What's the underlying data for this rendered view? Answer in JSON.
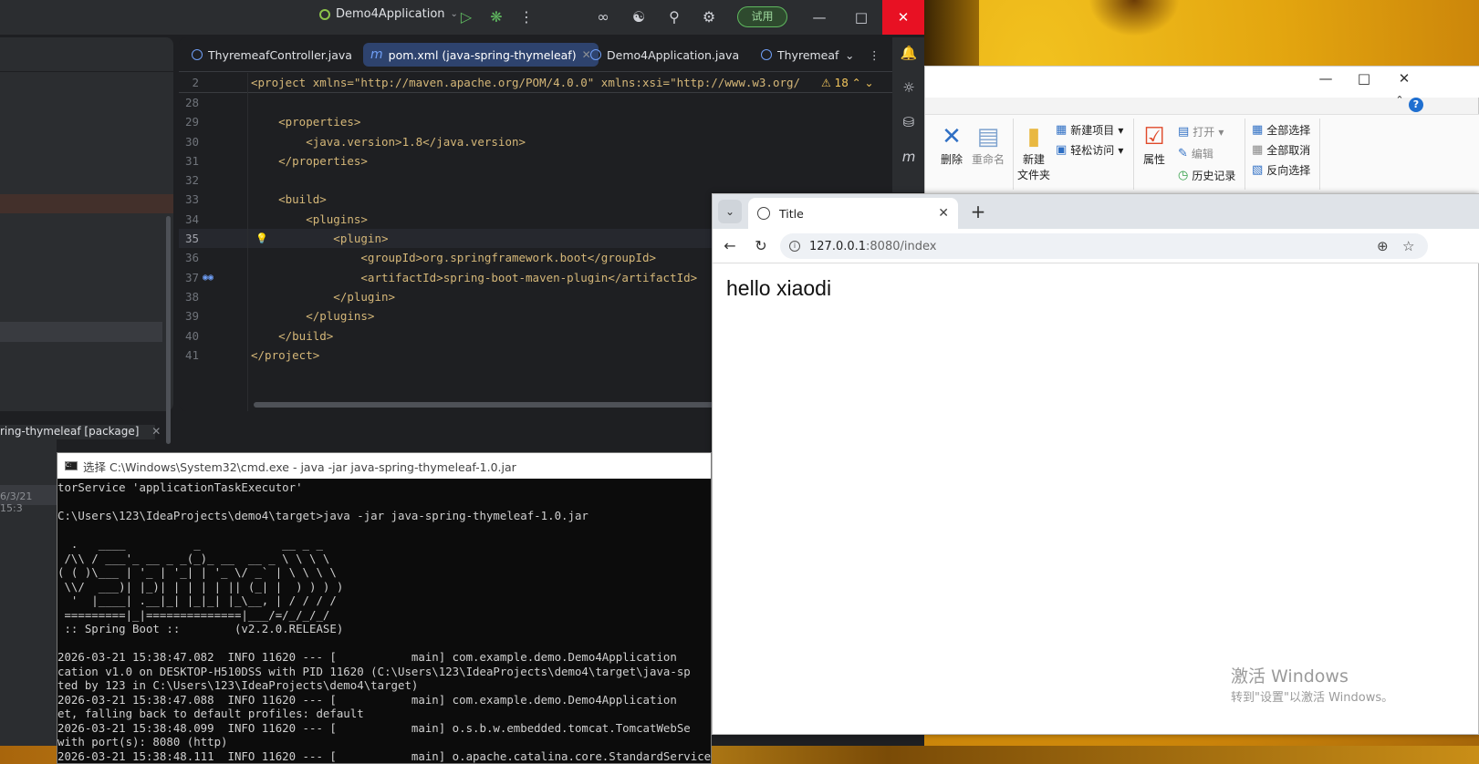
{
  "ide": {
    "run_config": "Demo4Application",
    "trial_label": "试用",
    "tabs": [
      {
        "label": "ThyremeafController.java"
      },
      {
        "label": "pom.xml (java-spring-thymeleaf)"
      },
      {
        "label": "Demo4Application.java"
      },
      {
        "label": "Thyremeaf"
      }
    ],
    "sticky": {
      "line": "2",
      "text": "<project xmlns=\"http://maven.apache.org/POM/4.0.0\" xmlns:xsi=\"http://www.w3.org/",
      "warnings": "18"
    },
    "lines": [
      {
        "n": "28",
        "c": ""
      },
      {
        "n": "29",
        "c": "    <properties>"
      },
      {
        "n": "30",
        "c": "        <java.version>1.8</java.version>"
      },
      {
        "n": "31",
        "c": "    </properties>"
      },
      {
        "n": "32",
        "c": ""
      },
      {
        "n": "33",
        "c": "    <build>"
      },
      {
        "n": "34",
        "c": "        <plugins>"
      },
      {
        "n": "35",
        "c": "            <plugin>"
      },
      {
        "n": "36",
        "c": "                <groupId>org.springframework.boot</groupId>"
      },
      {
        "n": "37",
        "c": "                <artifactId>spring-boot-maven-plugin</artifactId>"
      },
      {
        "n": "38",
        "c": "            </plugin>"
      },
      {
        "n": "39",
        "c": "        </plugins>"
      },
      {
        "n": "40",
        "c": "    </build>"
      },
      {
        "n": "41",
        "c": "</project>"
      }
    ],
    "bottom_tab": "ring-thymeleaf [package]",
    "side_time": "6/3/21 15:3"
  },
  "explorer": {
    "delete": "删除",
    "rename": "重命名",
    "new_folder_1": "新建",
    "new_folder_2": "文件夹",
    "new_item": "新建项目",
    "easy_access": "轻松访问",
    "properties": "属性",
    "open": "打开",
    "edit": "编辑",
    "history": "历史记录",
    "select_all": "全部选择",
    "select_none": "全部取消",
    "invert": "反向选择"
  },
  "browser": {
    "tab_title": "Title",
    "url_host": "127.0.0.1",
    "url_rest": ":8080/index",
    "page_text": "hello xiaodi",
    "watermark_1": "激活 Windows",
    "watermark_2": "转到\"设置\"以激活 Windows。"
  },
  "cmd": {
    "title": "选择 C:\\Windows\\System32\\cmd.exe - java  -jar java-spring-thymeleaf-1.0.jar",
    "lines": [
      "torService 'applicationTaskExecutor'",
      "",
      "C:\\Users\\123\\IdeaProjects\\demo4\\target>java -jar java-spring-thymeleaf-1.0.jar",
      "",
      "  .   ____          _            __ _ _",
      " /\\\\ / ___'_ __ _ _(_)_ __  __ _ \\ \\ \\ \\",
      "( ( )\\___ | '_ | '_| | '_ \\/ _` | \\ \\ \\ \\",
      " \\\\/  ___)| |_)| | | | | || (_| |  ) ) ) )",
      "  '  |____| .__|_| |_|_| |_\\__, | / / / /",
      " =========|_|==============|___/=/_/_/_/",
      " :: Spring Boot ::        (v2.2.0.RELEASE)",
      "",
      "2026-03-21 15:38:47.082  INFO 11620 --- [           main] com.example.demo.Demo4Application",
      "cation v1.0 on DESKTOP-H510DSS with PID 11620 (C:\\Users\\123\\IdeaProjects\\demo4\\target\\java-sp",
      "ted by 123 in C:\\Users\\123\\IdeaProjects\\demo4\\target)",
      "2026-03-21 15:38:47.088  INFO 11620 --- [           main] com.example.demo.Demo4Application",
      "et, falling back to default profiles: default",
      "2026-03-21 15:38:48.099  INFO 11620 --- [           main] o.s.b.w.embedded.tomcat.TomcatWebSe",
      "with port(s): 8080 (http)",
      "2026-03-21 15:38:48.111  INFO 11620 --- [           main] o.apache.catalina.core.StandardService"
    ]
  }
}
